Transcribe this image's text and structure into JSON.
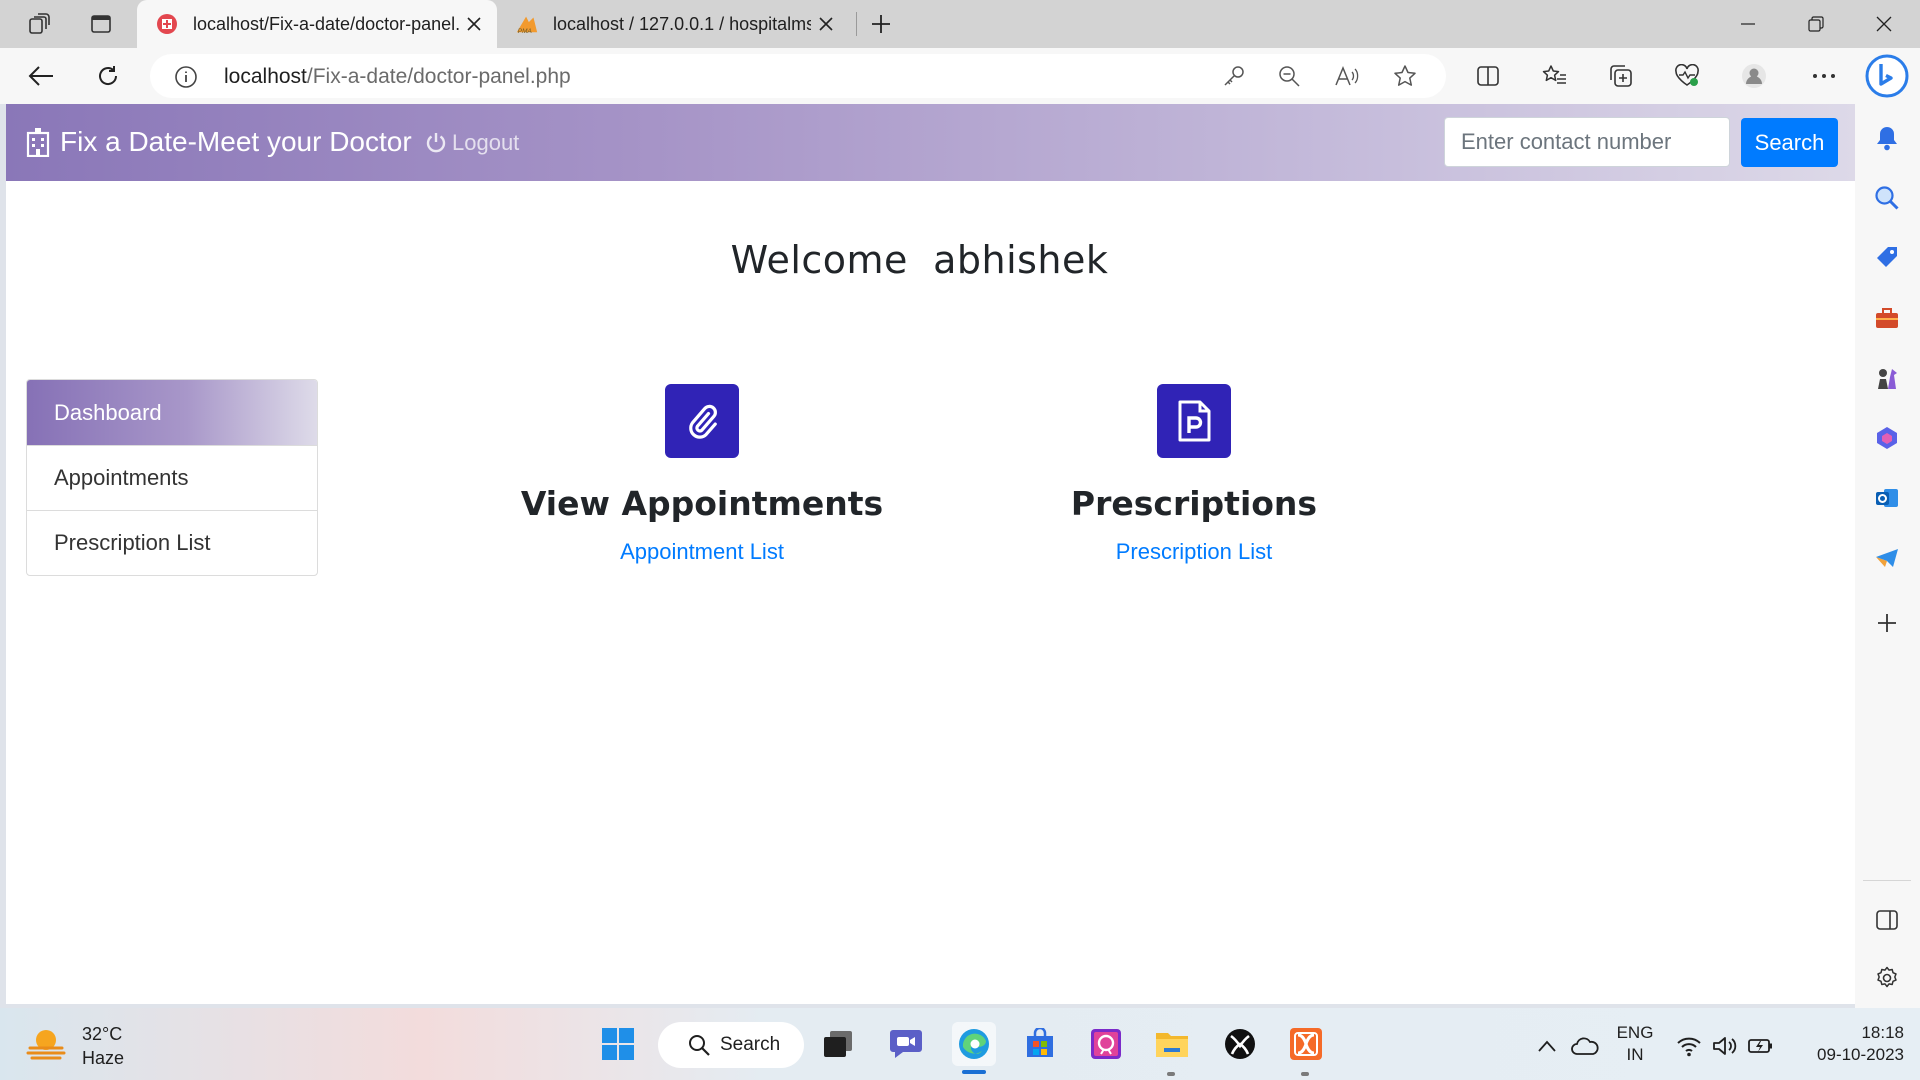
{
  "browser": {
    "tabs": [
      {
        "title": "localhost/Fix-a-date/doctor-panel.php",
        "active": true
      },
      {
        "title": "localhost / 127.0.0.1 / hospitalms",
        "active": false
      }
    ],
    "url_host": "localhost",
    "url_path": "/Fix-a-date/doctor-panel.php"
  },
  "site": {
    "brand": "Fix a Date-Meet your Doctor",
    "logout_label": "Logout",
    "search_placeholder": "Enter contact number",
    "search_button": "Search",
    "welcome": "Welcome  abhishek",
    "menu": [
      {
        "label": "Dashboard",
        "active": true
      },
      {
        "label": "Appointments",
        "active": false
      },
      {
        "label": "Prescription List",
        "active": false
      }
    ],
    "cards": [
      {
        "title": "View Appointments",
        "link": "Appointment List",
        "icon": "paperclip-icon"
      },
      {
        "title": "Prescriptions",
        "link": "Prescription List",
        "icon": "prescription-file-icon"
      }
    ],
    "colors": {
      "accent": "#007bff",
      "card_icon_bg": "#3023b6",
      "navbar_start": "#8a77b8"
    }
  },
  "taskbar": {
    "weather_temp": "32°C",
    "weather_desc": "Haze",
    "search_label": "Search",
    "lang_top": "ENG",
    "lang_bottom": "IN",
    "time": "18:18",
    "date": "09-10-2023"
  }
}
